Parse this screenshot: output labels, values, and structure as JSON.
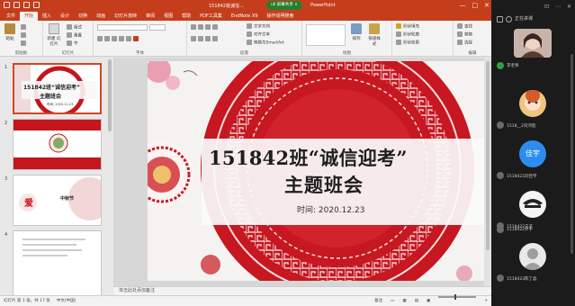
{
  "titlebar": {
    "filename": "151842班诚信...",
    "share_pill": "ull 屏幕共享 ∨",
    "app": "PowerPoint",
    "minimize": "—",
    "maximize": "□",
    "close": "✕"
  },
  "ribbon_tabs": [
    "文件",
    "开始",
    "插入",
    "设计",
    "切换",
    "动画",
    "幻灯片放映",
    "审阅",
    "视图",
    "帮助",
    "PDF工具集",
    "EndNote X9",
    "操作说明搜索"
  ],
  "ribbon": {
    "paste": "粘贴",
    "clipboard": "剪贴板",
    "new_slide": "新建\n幻灯片",
    "reuse_slide": "重用\n幻灯片",
    "layout": "版式",
    "reset": "重置",
    "section": "节",
    "slides_group": "幻灯片",
    "font_group": "字体",
    "paragraph_group": "段落",
    "text_direction": "文字方向",
    "align_text": "对齐文本",
    "smartart": "转换为SmartArt",
    "drawing_group": "绘图",
    "shape_fill": "形状填充",
    "shape_outline": "形状轮廓",
    "shape_effects": "形状效果",
    "find": "查找",
    "replace": "替换",
    "select": "选择",
    "editing_group": "编辑",
    "arrange": "排列",
    "quick_styles": "快速样式"
  },
  "thumbnails": [
    {
      "num": "1",
      "title": "151842班“诚信迎考”",
      "subtitle": "主题班会",
      "date": "时间: 2020.12.23"
    },
    {
      "num": "2"
    },
    {
      "num": "3",
      "word": "中秋节"
    },
    {
      "num": "4"
    }
  ],
  "slide": {
    "title": "151842班“诚信迎考”",
    "subtitle": "主题班会",
    "date": "时间:   2020.12.23"
  },
  "notes_placeholder": "单击此处添加备注",
  "status": {
    "slide_count": "幻灯片 第 1 张，共 17 张",
    "language": "中文(中国)",
    "notes": "备注",
    "zoom": "+"
  },
  "panel": {
    "header": "正在讲课",
    "participants": [
      {
        "name": "李老师"
      },
      {
        "name": "1518__2刘鸿程"
      },
      {
        "name": "1518423刘佳宇",
        "avatar_text": "佳宇"
      },
      {
        "name": "1518422王子"
      },
      {
        "name": "1518422罗字"
      },
      {
        "name": "1518423陈丁晶"
      }
    ]
  }
}
